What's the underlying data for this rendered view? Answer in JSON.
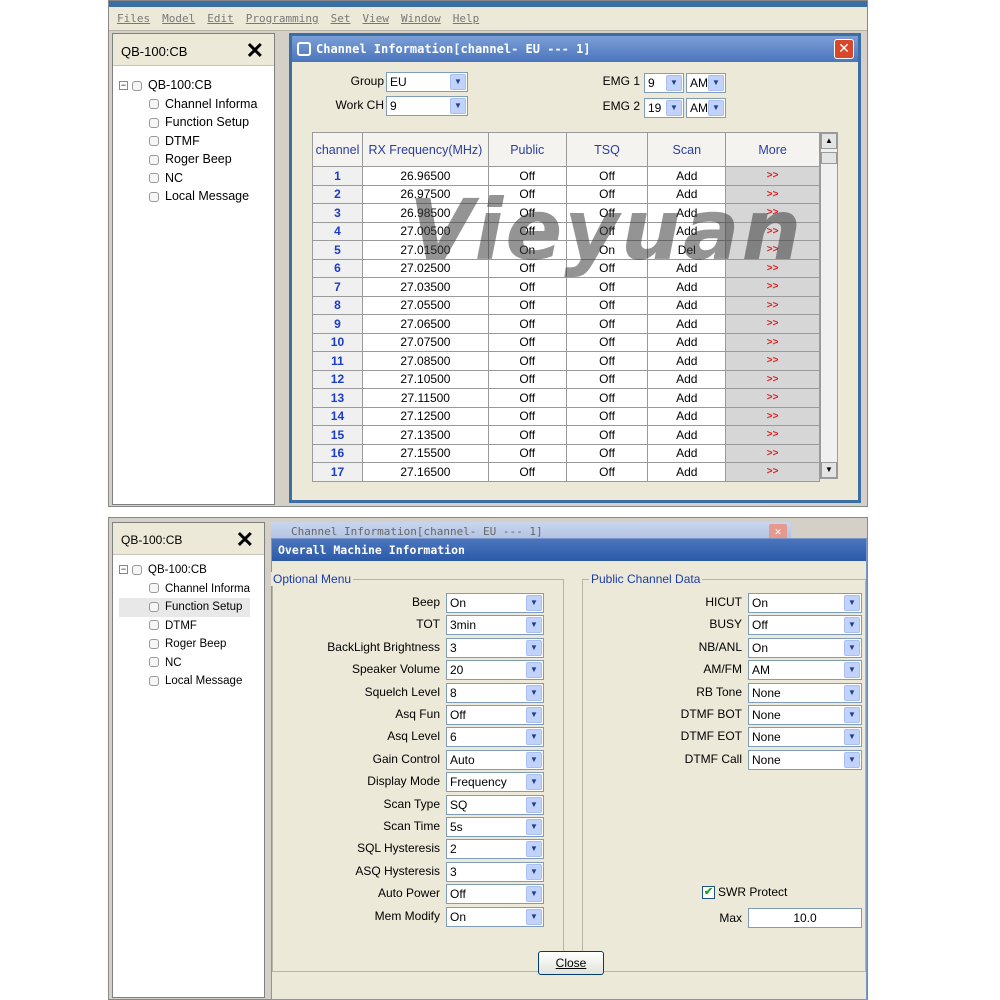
{
  "top": {
    "menu": [
      "Files",
      "Model",
      "Edit",
      "Programming",
      "Set",
      "View",
      "Window",
      "Help"
    ],
    "tree": {
      "header": "QB-100:CB",
      "root": "QB-100:CB",
      "items": [
        "Channel Informa",
        "Function Setup",
        "DTMF",
        "Roger Beep",
        "NC",
        "Local Message"
      ]
    },
    "window": {
      "title": "Channel Information[channel- EU ---  1]",
      "group_label": "Group",
      "group_value": "EU",
      "workch_label": "Work CH",
      "workch_value": "9",
      "emg1_label": "EMG 1",
      "emg1_value": "9",
      "emg1_mode": "AM",
      "emg2_label": "EMG 2",
      "emg2_value": "19",
      "emg2_mode": "AM"
    },
    "columns": [
      "channel",
      "RX Frequency(MHz)",
      "Public",
      "TSQ",
      "Scan",
      "More"
    ],
    "rows": [
      [
        "1",
        "26.96500",
        "Off",
        "Off",
        "Add",
        ">>"
      ],
      [
        "2",
        "26.97500",
        "Off",
        "Off",
        "Add",
        ">>"
      ],
      [
        "3",
        "26.98500",
        "Off",
        "Off",
        "Add",
        ">>"
      ],
      [
        "4",
        "27.00500",
        "Off",
        "Off",
        "Add",
        ">>"
      ],
      [
        "5",
        "27.01500",
        "On",
        "On",
        "Del",
        ">>"
      ],
      [
        "6",
        "27.02500",
        "Off",
        "Off",
        "Add",
        ">>"
      ],
      [
        "7",
        "27.03500",
        "Off",
        "Off",
        "Add",
        ">>"
      ],
      [
        "8",
        "27.05500",
        "Off",
        "Off",
        "Add",
        ">>"
      ],
      [
        "9",
        "27.06500",
        "Off",
        "Off",
        "Add",
        ">>"
      ],
      [
        "10",
        "27.07500",
        "Off",
        "Off",
        "Add",
        ">>"
      ],
      [
        "11",
        "27.08500",
        "Off",
        "Off",
        "Add",
        ">>"
      ],
      [
        "12",
        "27.10500",
        "Off",
        "Off",
        "Add",
        ">>"
      ],
      [
        "13",
        "27.11500",
        "Off",
        "Off",
        "Add",
        ">>"
      ],
      [
        "14",
        "27.12500",
        "Off",
        "Off",
        "Add",
        ">>"
      ],
      [
        "15",
        "27.13500",
        "Off",
        "Off",
        "Add",
        ">>"
      ],
      [
        "16",
        "27.15500",
        "Off",
        "Off",
        "Add",
        ">>"
      ],
      [
        "17",
        "27.16500",
        "Off",
        "Off",
        "Add",
        ">>"
      ]
    ],
    "watermark": "Vieyuan"
  },
  "bottom": {
    "tree": {
      "header": "QB-100:CB",
      "root": "QB-100:CB",
      "items": [
        "Channel Informa",
        "Function Setup",
        "DTMF",
        "Roger Beep",
        "NC",
        "Local Message"
      ]
    },
    "behind_title": "Channel Information[channel- EU ---  1]",
    "window_title": "Overall Machine Information",
    "optional_menu": {
      "title": "Optional Menu",
      "fields": [
        {
          "label": "Beep",
          "value": "On"
        },
        {
          "label": "TOT",
          "value": "3min"
        },
        {
          "label": "BackLight Brightness",
          "value": "3"
        },
        {
          "label": "Speaker Volume",
          "value": "20"
        },
        {
          "label": "Squelch Level",
          "value": "8"
        },
        {
          "label": "Asq Fun",
          "value": "Off"
        },
        {
          "label": "Asq Level",
          "value": "6"
        },
        {
          "label": "Gain Control",
          "value": "Auto"
        },
        {
          "label": "Display Mode",
          "value": "Frequency"
        },
        {
          "label": "Scan Type",
          "value": "SQ"
        },
        {
          "label": "Scan Time",
          "value": "5s"
        },
        {
          "label": "SQL Hysteresis",
          "value": "2"
        },
        {
          "label": "ASQ Hysteresis",
          "value": "3"
        },
        {
          "label": "Auto Power",
          "value": "Off"
        },
        {
          "label": "Mem Modify",
          "value": "On"
        }
      ]
    },
    "public_channel": {
      "title": "Public Channel Data",
      "fields": [
        {
          "label": "HICUT",
          "value": "On"
        },
        {
          "label": "BUSY",
          "value": "Off"
        },
        {
          "label": "NB/ANL",
          "value": "On"
        },
        {
          "label": "AM/FM",
          "value": "AM"
        },
        {
          "label": "RB Tone",
          "value": "None"
        },
        {
          "label": "DTMF BOT",
          "value": "None"
        },
        {
          "label": "DTMF EOT",
          "value": "None"
        },
        {
          "label": "DTMF Call",
          "value": "None"
        }
      ],
      "swr_label": "SWR Protect",
      "swr_checked": true,
      "max_label": "Max",
      "max_value": "10.0"
    },
    "close_label": "Close"
  }
}
